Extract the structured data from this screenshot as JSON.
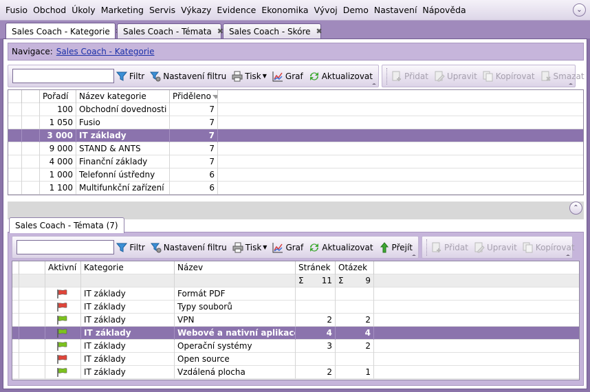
{
  "menu": [
    "Fusio",
    "Obchod",
    "Úkoly",
    "Marketing",
    "Servis",
    "Výkazy",
    "Evidence",
    "Ekonomika",
    "Vývoj",
    "Demo",
    "Nastavení",
    "Nápověda"
  ],
  "tabs": [
    {
      "label": "Sales Coach - Kategorie",
      "active": true
    },
    {
      "label": "Sales Coach - Témata",
      "active": false
    },
    {
      "label": "Sales Coach - Skóre",
      "active": false
    }
  ],
  "nav": {
    "label": "Navigace:",
    "link": "Sales Coach - Kategorie"
  },
  "toolbar1": {
    "filter": "Filtr",
    "filter_settings": "Nastavení filtru",
    "print": "Tisk",
    "chart": "Graf",
    "refresh": "Aktualizovat",
    "add": "Přidat",
    "edit": "Upravit",
    "copy": "Kopírovat",
    "delete": "Smazat"
  },
  "grid1": {
    "headers": {
      "order": "Pořadí",
      "name": "Název kategorie",
      "assigned": "Přiděleno"
    },
    "rows": [
      {
        "order": "100",
        "name": "Obchodní dovednosti",
        "assigned": "7"
      },
      {
        "order": "1 050",
        "name": "Fusio",
        "assigned": "7"
      },
      {
        "order": "3 000",
        "name": "IT základy",
        "assigned": "7"
      },
      {
        "order": "9 000",
        "name": "STAND & ANTS",
        "assigned": "7"
      },
      {
        "order": "4 000",
        "name": "Finanční základy",
        "assigned": "7"
      },
      {
        "order": "1 000",
        "name": "Telefonní ústředny",
        "assigned": "6"
      },
      {
        "order": "1 100",
        "name": "Multifunkční zařízení",
        "assigned": "6"
      }
    ],
    "selected_index": 2
  },
  "subtab": "Sales Coach - Témata (7)",
  "toolbar2": {
    "filter": "Filtr",
    "filter_settings": "Nastavení filtru",
    "print": "Tisk",
    "chart": "Graf",
    "refresh": "Aktualizovat",
    "goto": "Přejít",
    "add": "Přidat",
    "edit": "Upravit",
    "copy": "Kopírovat"
  },
  "grid2": {
    "headers": {
      "active": "Aktivní",
      "category": "Kategorie",
      "name": "Název",
      "pages": "Stránek",
      "questions": "Otázek"
    },
    "sums": {
      "pages_sym": "Σ",
      "pages": "11",
      "questions_sym": "Σ",
      "questions": "9"
    },
    "rows": [
      {
        "flag": "red",
        "category": "IT základy",
        "name": "Formát PDF",
        "pages": "",
        "questions": ""
      },
      {
        "flag": "red",
        "category": "IT základy",
        "name": "Typy souborů",
        "pages": "",
        "questions": ""
      },
      {
        "flag": "green",
        "category": "IT základy",
        "name": "VPN",
        "pages": "2",
        "questions": "2"
      },
      {
        "flag": "green",
        "category": "IT základy",
        "name": "Webové a nativní aplikace",
        "pages": "4",
        "questions": "4"
      },
      {
        "flag": "green",
        "category": "IT základy",
        "name": "Operační systémy",
        "pages": "3",
        "questions": "2"
      },
      {
        "flag": "red",
        "category": "IT základy",
        "name": "Open source",
        "pages": "",
        ":": "",
        "questions": ""
      },
      {
        "flag": "green",
        "category": "IT základy",
        "name": "Vzdálená plocha",
        "pages": "2",
        "questions": "1"
      }
    ],
    "selected_index": 3
  },
  "colors": {
    "accent": "#8b73ad",
    "flag_red": "#e0453a",
    "flag_green": "#7cc21e"
  }
}
